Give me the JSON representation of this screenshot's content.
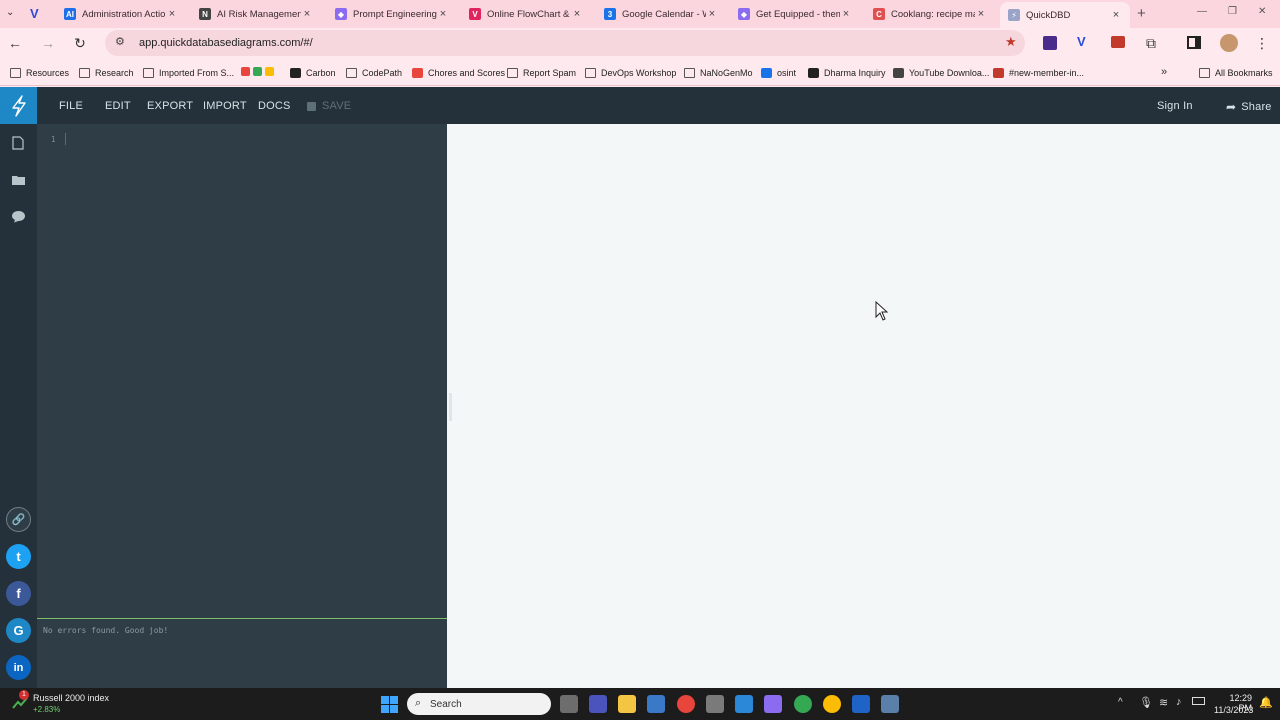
{
  "browser": {
    "tabs": [
      {
        "title": "Administration Actio",
        "fav_color": "#1f6feb",
        "fav_text": "AI"
      },
      {
        "title": "AI Risk Management",
        "fav_color": "#444444",
        "fav_text": "N"
      },
      {
        "title": "Prompt Engineering",
        "fav_color": "#8b6cf0",
        "fav_text": "◆"
      },
      {
        "title": "Online FlowChart & D",
        "fav_color": "#e0245e",
        "fav_text": "V"
      },
      {
        "title": "Google Calendar - W",
        "fav_color": "#1a73e8",
        "fav_text": "3"
      },
      {
        "title": "Get Equipped - them",
        "fav_color": "#8b6cf0",
        "fav_text": "◆"
      },
      {
        "title": "Cooklang: recipe ma",
        "fav_color": "#e05050",
        "fav_text": "C"
      },
      {
        "title": "QuickDBD",
        "fav_color": "#9aa4c8",
        "fav_text": "⚡"
      }
    ],
    "url": "app.quickdatabasediagrams.com/#/",
    "bookmarks": [
      {
        "label": "Resources",
        "kind": "folder"
      },
      {
        "label": "Research",
        "kind": "folder"
      },
      {
        "label": "Imported From S...",
        "kind": "folder"
      },
      {
        "label": "Carbon",
        "kind": "site"
      },
      {
        "label": "CodePath",
        "kind": "folder"
      },
      {
        "label": "Chores and Scores",
        "kind": "site"
      },
      {
        "label": "Report Spam",
        "kind": "folder"
      },
      {
        "label": "DevOps Workshop",
        "kind": "folder"
      },
      {
        "label": "NaNoGenMo",
        "kind": "folder"
      },
      {
        "label": "osint",
        "kind": "site"
      },
      {
        "label": "Dharma Inquiry",
        "kind": "site"
      },
      {
        "label": "YouTube Downloa...",
        "kind": "site"
      },
      {
        "label": "#new-member-in...",
        "kind": "site"
      }
    ],
    "all_bookmarks": "All Bookmarks"
  },
  "app": {
    "menu": [
      "FILE",
      "EDIT",
      "EXPORT",
      "IMPORT",
      "DOCS"
    ],
    "save_label": "SAVE",
    "sign_in": "Sign In",
    "share": "Share",
    "line_number": "1",
    "status_message": "No errors found. Good job!",
    "colors": {
      "topbar": "#24313a",
      "editor": "#2f3e46",
      "logo_bg": "#1e88c7",
      "canvas": "#f4f7f8"
    }
  },
  "taskbar": {
    "widget_title": "Russell 2000 index",
    "widget_value": "+2.83%",
    "search_label": "Search",
    "time": "12:29 PM",
    "date": "11/3/2023"
  }
}
